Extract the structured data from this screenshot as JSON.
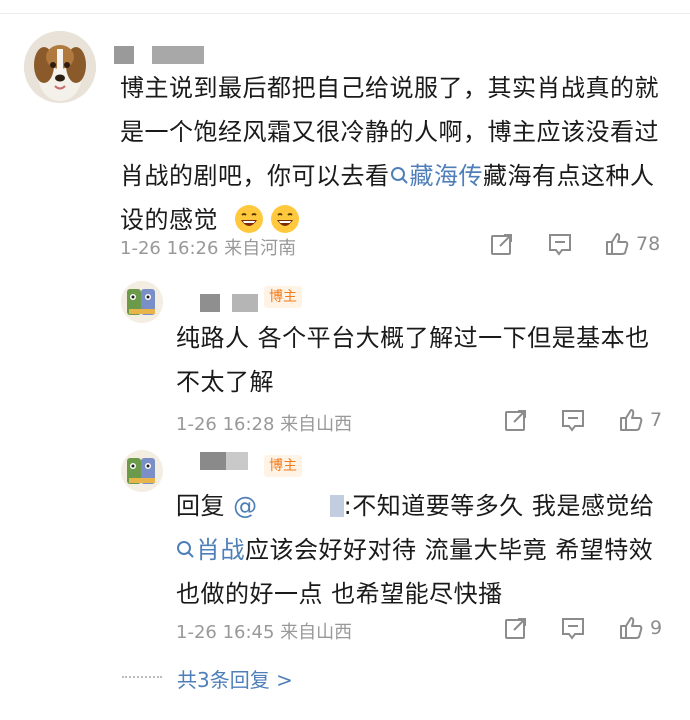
{
  "comment": {
    "text_parts": {
      "before": "博主说到最后都把自己给说服了，其实肖战真的就是一个饱经风霜又很冷静的人啊，博主应该没看过肖战的剧吧，你可以去看",
      "link": "藏海传",
      "after": "藏海有点这种人设的感觉"
    },
    "emojis": [
      "grin-emoji",
      "grin-emoji"
    ],
    "meta": "1-26 16:26 来自河南",
    "likes": "78"
  },
  "replies": [
    {
      "badge": "博主",
      "text": "纯路人 各个平台大概了解过一下但是基本也不太了解",
      "meta": "1-26 16:28 来自山西",
      "likes": "7"
    },
    {
      "badge": "博主",
      "reply_prefix": "回复",
      "mention": "@",
      "text_after_mention": ":不知道要等多久 我是感觉给",
      "link": "肖战",
      "text_rest": "应该会好好对待 流量大毕竟 希望特效也做的好一点 也希望能尽快播",
      "meta": "1-26 16:45 来自山西",
      "likes": "9"
    }
  ],
  "more_replies": "共3条回复 >",
  "colors": {
    "link": "#4f7fb8",
    "meta": "#999999",
    "badge_bg": "#fff3e6",
    "badge_text": "#f27b1a"
  }
}
